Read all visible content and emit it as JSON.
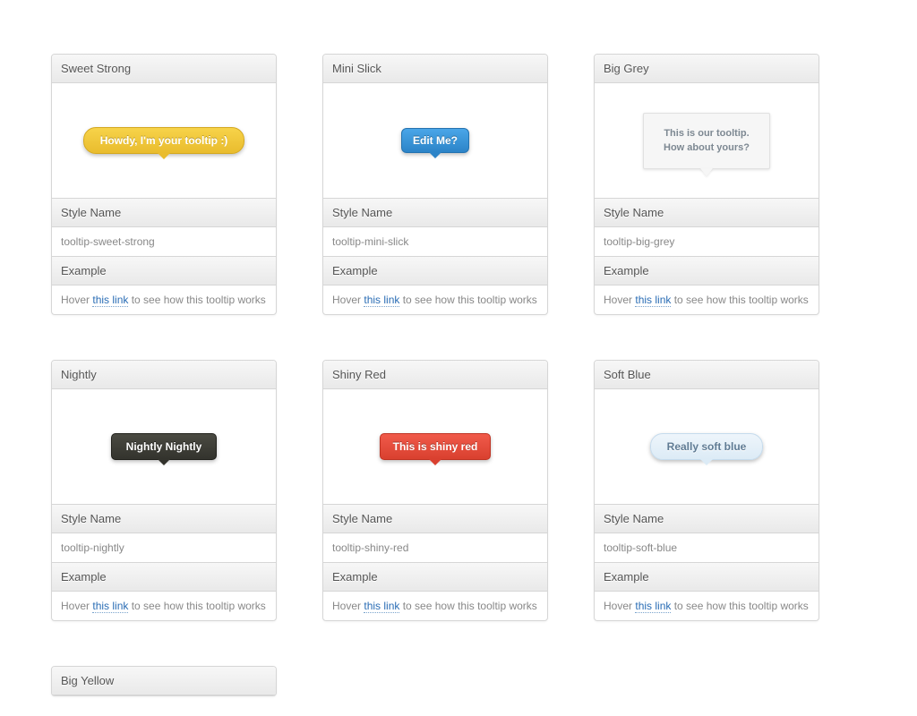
{
  "labels": {
    "style_name": "Style Name",
    "example": "Example",
    "hover_prefix": "Hover",
    "hover_link": "this link",
    "hover_suffix": "to see how this tooltip works"
  },
  "cards": [
    {
      "title": "Sweet Strong",
      "tooltip_text": "Howdy, I'm your tooltip :)",
      "style_class": "tooltip-sweet-strong",
      "bubble_class": "sweet-strong"
    },
    {
      "title": "Mini Slick",
      "tooltip_text": "Edit Me?",
      "style_class": "tooltip-mini-slick",
      "bubble_class": "mini-slick"
    },
    {
      "title": "Big Grey",
      "tooltip_text": "This is our tooltip.\nHow about yours?",
      "style_class": "tooltip-big-grey",
      "bubble_class": "big-grey"
    },
    {
      "title": "Nightly",
      "tooltip_text": "Nightly Nightly",
      "style_class": "tooltip-nightly",
      "bubble_class": "nightly"
    },
    {
      "title": "Shiny Red",
      "tooltip_text": "This is shiny red",
      "style_class": "tooltip-shiny-red",
      "bubble_class": "shiny-red"
    },
    {
      "title": "Soft Blue",
      "tooltip_text": "Really soft blue",
      "style_class": "tooltip-soft-blue",
      "bubble_class": "soft-blue"
    },
    {
      "title": "Big Yellow",
      "tooltip_text": "",
      "style_class": "tooltip-big-yellow",
      "bubble_class": "big-yellow",
      "header_only": true
    }
  ]
}
